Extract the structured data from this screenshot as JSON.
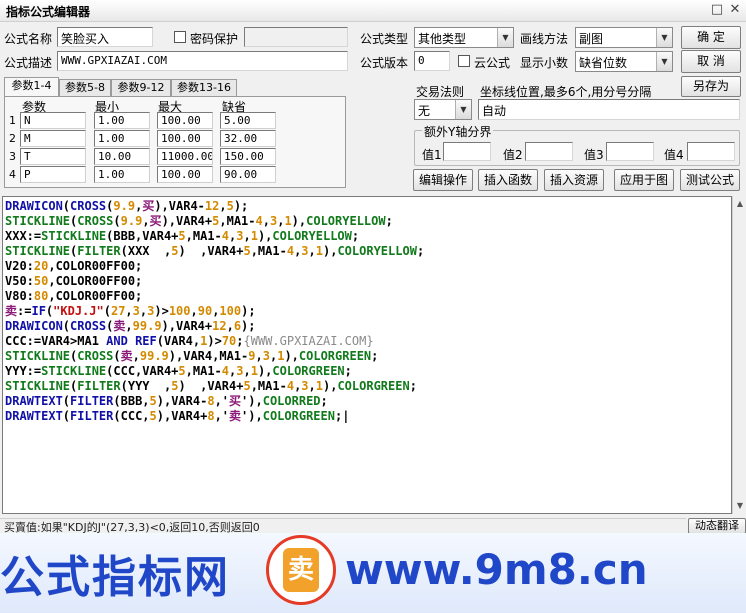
{
  "window": {
    "title": "指标公式编辑器"
  },
  "form": {
    "name_label": "公式名称",
    "name_value": "笑脸买入",
    "password_label": "密码保护",
    "desc_label": "公式描述",
    "desc_value": "WWW.GPXIAZAI.COM",
    "type_label": "公式类型",
    "type_value": "其他类型",
    "draw_method_label": "画线方法",
    "draw_method_value": "副图",
    "version_label": "公式版本",
    "version_value": "0",
    "cloud_label": "云公式",
    "decimals_label": "显示小数",
    "decimals_value": "缺省位数",
    "trade_rule_label": "交易法则",
    "trade_rule_value": "无",
    "coord_label": "坐标线位置,最多6个,用分号分隔",
    "coord_value": "自动",
    "yaxis_label": "额外Y轴分界",
    "y_values": [
      {
        "label": "值1",
        "value": ""
      },
      {
        "label": "值2",
        "value": ""
      },
      {
        "label": "值3",
        "value": ""
      },
      {
        "label": "值4",
        "value": ""
      }
    ]
  },
  "buttons": {
    "ok": "确  定",
    "cancel": "取  消",
    "save_as": "另存为",
    "edit_op": "编辑操作",
    "insert_func": "插入函数",
    "insert_res": "插入资源",
    "apply_chart": "应用于图",
    "test": "测试公式",
    "dynamic_translate": "动态翻译"
  },
  "tabs": [
    "参数1-4",
    "参数5-8",
    "参数9-12",
    "参数13-16"
  ],
  "params": {
    "headers": [
      "参数",
      "最小",
      "最大",
      "缺省"
    ],
    "rows": [
      {
        "idx": "1",
        "name": "N",
        "min": "1.00",
        "max": "100.00",
        "def": "5.00"
      },
      {
        "idx": "2",
        "name": "M",
        "min": "1.00",
        "max": "100.00",
        "def": "32.00"
      },
      {
        "idx": "3",
        "name": "T",
        "min": "10.00",
        "max": "11000.00",
        "def": "150.00"
      },
      {
        "idx": "4",
        "name": "P",
        "min": "1.00",
        "max": "100.00",
        "def": "90.00"
      }
    ]
  },
  "code": [
    [
      [
        "blue",
        "DRAWICON"
      ],
      [
        "black",
        "("
      ],
      [
        "blue",
        "CROSS"
      ],
      [
        "black",
        "("
      ],
      [
        "orange",
        "9.9"
      ],
      [
        "black",
        ","
      ],
      [
        "purple",
        "买"
      ],
      [
        "black",
        "),VAR4-"
      ],
      [
        "orange",
        "12"
      ],
      [
        "black",
        ","
      ],
      [
        "orange",
        "5"
      ],
      [
        "black",
        ");"
      ]
    ],
    [
      [
        "green",
        "STICKLINE"
      ],
      [
        "black",
        "("
      ],
      [
        "green",
        "CROSS"
      ],
      [
        "black",
        "("
      ],
      [
        "orange",
        "9.9"
      ],
      [
        "black",
        ","
      ],
      [
        "purple",
        "买"
      ],
      [
        "black",
        "),VAR4+"
      ],
      [
        "orange",
        "5"
      ],
      [
        "black",
        ",MA1-"
      ],
      [
        "orange",
        "4"
      ],
      [
        "black",
        ","
      ],
      [
        "orange",
        "3"
      ],
      [
        "black",
        ","
      ],
      [
        "orange",
        "1"
      ],
      [
        "black",
        "),"
      ],
      [
        "green",
        "COLORYELLOW"
      ],
      [
        "black",
        ";"
      ]
    ],
    [
      [
        "black",
        "XXX:="
      ],
      [
        "green",
        "STICKLINE"
      ],
      [
        "black",
        "(BBB,VAR4+"
      ],
      [
        "orange",
        "5"
      ],
      [
        "black",
        ",MA1-"
      ],
      [
        "orange",
        "4"
      ],
      [
        "black",
        ","
      ],
      [
        "orange",
        "3"
      ],
      [
        "black",
        ","
      ],
      [
        "orange",
        "1"
      ],
      [
        "black",
        "),"
      ],
      [
        "green",
        "COLORYELLOW"
      ],
      [
        "black",
        ";"
      ]
    ],
    [
      [
        "green",
        "STICKLINE"
      ],
      [
        "black",
        "("
      ],
      [
        "green",
        "FILTER"
      ],
      [
        "black",
        "(XXX  ,"
      ],
      [
        "orange",
        "5"
      ],
      [
        "black",
        ")  ,VAR4+"
      ],
      [
        "orange",
        "5"
      ],
      [
        "black",
        ",MA1-"
      ],
      [
        "orange",
        "4"
      ],
      [
        "black",
        ","
      ],
      [
        "orange",
        "3"
      ],
      [
        "black",
        ","
      ],
      [
        "orange",
        "1"
      ],
      [
        "black",
        "),"
      ],
      [
        "green",
        "COLORYELLOW"
      ],
      [
        "black",
        ";"
      ]
    ],
    [
      [
        "black",
        "V20:"
      ],
      [
        "orange",
        "20"
      ],
      [
        "black",
        ",COLOR00FF00;"
      ]
    ],
    [
      [
        "black",
        "V50:"
      ],
      [
        "orange",
        "50"
      ],
      [
        "black",
        ",COLOR00FF00;"
      ]
    ],
    [
      [
        "black",
        "V80:"
      ],
      [
        "orange",
        "80"
      ],
      [
        "black",
        ",COLOR00FF00;"
      ]
    ],
    [
      [
        "purple",
        "卖"
      ],
      [
        "black",
        ":="
      ],
      [
        "blue",
        "IF"
      ],
      [
        "black",
        "("
      ],
      [
        "red",
        "\"KDJ.J\""
      ],
      [
        "black",
        "("
      ],
      [
        "orange",
        "27"
      ],
      [
        "black",
        ","
      ],
      [
        "orange",
        "3"
      ],
      [
        "black",
        ","
      ],
      [
        "orange",
        "3"
      ],
      [
        "black",
        ")>"
      ],
      [
        "orange",
        "100"
      ],
      [
        "black",
        ","
      ],
      [
        "orange",
        "90"
      ],
      [
        "black",
        ","
      ],
      [
        "orange",
        "100"
      ],
      [
        "black",
        ");"
      ]
    ],
    [
      [
        "blue",
        "DRAWICON"
      ],
      [
        "black",
        "("
      ],
      [
        "blue",
        "CROSS"
      ],
      [
        "black",
        "("
      ],
      [
        "purple",
        "卖"
      ],
      [
        "black",
        ","
      ],
      [
        "orange",
        "99.9"
      ],
      [
        "black",
        "),VAR4+"
      ],
      [
        "orange",
        "12"
      ],
      [
        "black",
        ","
      ],
      [
        "orange",
        "6"
      ],
      [
        "black",
        ");"
      ]
    ],
    [
      [
        "black",
        "CCC:=VAR4>MA1 "
      ],
      [
        "blue",
        "AND"
      ],
      [
        "black",
        " "
      ],
      [
        "blue",
        "REF"
      ],
      [
        "black",
        "(VAR4,"
      ],
      [
        "orange",
        "1"
      ],
      [
        "black",
        ")>"
      ],
      [
        "orange",
        "70"
      ],
      [
        "black",
        ";"
      ],
      [
        "gray",
        "{WWW.GPXIAZAI.COM}"
      ]
    ],
    [
      [
        "green",
        "STICKLINE"
      ],
      [
        "black",
        "("
      ],
      [
        "green",
        "CROSS"
      ],
      [
        "black",
        "("
      ],
      [
        "purple",
        "卖"
      ],
      [
        "black",
        ","
      ],
      [
        "orange",
        "99.9"
      ],
      [
        "black",
        "),VAR4,MA1-"
      ],
      [
        "orange",
        "9"
      ],
      [
        "black",
        ","
      ],
      [
        "orange",
        "3"
      ],
      [
        "black",
        ","
      ],
      [
        "orange",
        "1"
      ],
      [
        "black",
        "),"
      ],
      [
        "green",
        "COLORGREEN"
      ],
      [
        "black",
        ";"
      ]
    ],
    [
      [
        "black",
        "YYY:="
      ],
      [
        "green",
        "STICKLINE"
      ],
      [
        "black",
        "(CCC,VAR4+"
      ],
      [
        "orange",
        "5"
      ],
      [
        "black",
        ",MA1-"
      ],
      [
        "orange",
        "4"
      ],
      [
        "black",
        ","
      ],
      [
        "orange",
        "3"
      ],
      [
        "black",
        ","
      ],
      [
        "orange",
        "1"
      ],
      [
        "black",
        "),"
      ],
      [
        "green",
        "COLORGREEN"
      ],
      [
        "black",
        ";"
      ]
    ],
    [
      [
        "green",
        "STICKLINE"
      ],
      [
        "black",
        "("
      ],
      [
        "green",
        "FILTER"
      ],
      [
        "black",
        "(YYY  ,"
      ],
      [
        "orange",
        "5"
      ],
      [
        "black",
        ")  ,VAR4+"
      ],
      [
        "orange",
        "5"
      ],
      [
        "black",
        ",MA1-"
      ],
      [
        "orange",
        "4"
      ],
      [
        "black",
        ","
      ],
      [
        "orange",
        "3"
      ],
      [
        "black",
        ","
      ],
      [
        "orange",
        "1"
      ],
      [
        "black",
        "),"
      ],
      [
        "green",
        "COLORGREEN"
      ],
      [
        "black",
        ";"
      ]
    ],
    [
      [
        "blue",
        "DRAWTEXT"
      ],
      [
        "black",
        "("
      ],
      [
        "blue",
        "FILTER"
      ],
      [
        "black",
        "(BBB,"
      ],
      [
        "orange",
        "5"
      ],
      [
        "black",
        "),VAR4-"
      ],
      [
        "orange",
        "8"
      ],
      [
        "black",
        ",'"
      ],
      [
        "purple",
        "买"
      ],
      [
        "black",
        "'),"
      ],
      [
        "green",
        "COLORRED"
      ],
      [
        "black",
        ";"
      ]
    ],
    [
      [
        "blue",
        "DRAWTEXT"
      ],
      [
        "black",
        "("
      ],
      [
        "blue",
        "FILTER"
      ],
      [
        "black",
        "(CCC,"
      ],
      [
        "orange",
        "5"
      ],
      [
        "black",
        "),VAR4+"
      ],
      [
        "orange",
        "8"
      ],
      [
        "black",
        ",'"
      ],
      [
        "purple",
        "卖"
      ],
      [
        "black",
        "'),"
      ],
      [
        "green",
        "COLORGREEN"
      ],
      [
        "black",
        ";|"
      ]
    ]
  ],
  "status_text": "买賣值:如果\"KDJ的J\"(27,3,3)<0,返回10,否则返回0",
  "watermark": {
    "left": "公式指标网",
    "logo": "卖",
    "right": "www.9m8.cn"
  }
}
